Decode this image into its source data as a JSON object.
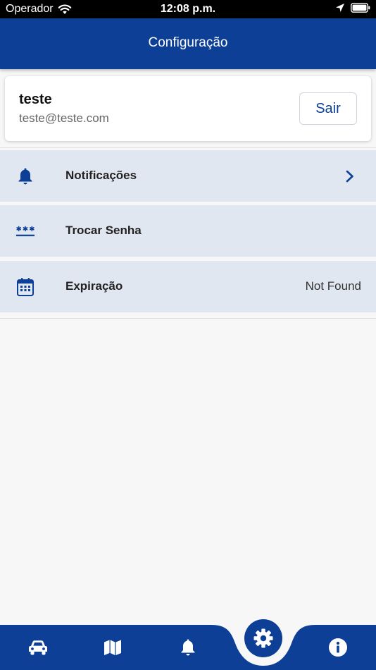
{
  "status_bar": {
    "carrier": "Operador",
    "time": "12:08 p.m."
  },
  "header": {
    "title": "Configuração"
  },
  "profile": {
    "name": "teste",
    "email": "teste@teste.com",
    "logout_label": "Sair"
  },
  "menu": {
    "items": [
      {
        "label": "Notificações",
        "icon": "bell-icon",
        "trailing": "chevron-right-icon"
      },
      {
        "label": "Trocar Senha",
        "icon": "password-icon"
      },
      {
        "label": "Expiração",
        "icon": "calendar-icon",
        "value": "Not Found"
      }
    ]
  },
  "tab_bar": {
    "tabs": [
      {
        "icon": "car-icon"
      },
      {
        "icon": "map-icon"
      },
      {
        "icon": "bell-icon"
      },
      {
        "icon": "gear-icon",
        "active": true
      },
      {
        "icon": "info-icon"
      }
    ]
  },
  "colors": {
    "primary": "#0d3f96",
    "row_background": "#e1e7f0",
    "page_background": "#f7f7f7"
  }
}
